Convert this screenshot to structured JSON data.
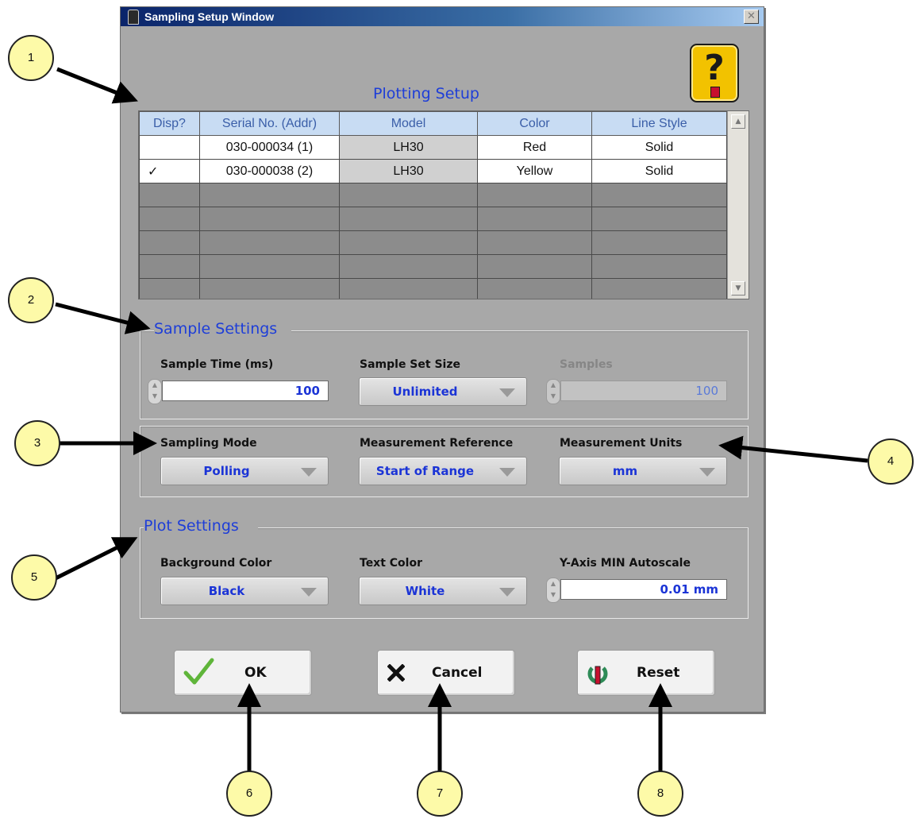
{
  "window": {
    "title": "Sampling Setup Window",
    "close_glyph": "✕",
    "help_glyph": "?"
  },
  "plotting": {
    "title": "Plotting Setup",
    "columns": [
      "Disp?",
      "Serial No. (Addr)",
      "Model",
      "Color",
      "Line Style"
    ],
    "rows": [
      [
        "",
        "030-000034 (1)",
        "LH30",
        "Red",
        "Solid"
      ],
      [
        "✓",
        "030-000038 (2)",
        "LH30",
        "Yellow",
        "Solid"
      ]
    ],
    "empty_rows": 5
  },
  "sample_settings": {
    "title": "Sample Settings",
    "sample_time_label": "Sample Time (ms)",
    "sample_time_value": "100",
    "set_size_label": "Sample Set Size",
    "set_size_value": "Unlimited",
    "samples_label": "Samples",
    "samples_value": "100"
  },
  "mode_settings": {
    "sampling_mode_label": "Sampling Mode",
    "sampling_mode_value": "Polling",
    "measurement_ref_label": "Measurement Reference",
    "measurement_ref_value": "Start of Range",
    "units_label": "Measurement Units",
    "units_value": "mm"
  },
  "plot_settings": {
    "title": "Plot Settings",
    "bg_label": "Background Color",
    "bg_value": "Black",
    "text_color_label": "Text Color",
    "text_color_value": "White",
    "yaxis_label": "Y-Axis MIN Autoscale",
    "yaxis_value": "0.01 mm"
  },
  "buttons": {
    "ok": "OK",
    "cancel": "Cancel",
    "reset": "Reset"
  },
  "callouts": [
    "1",
    "2",
    "3",
    "4",
    "5",
    "6",
    "7",
    "8"
  ],
  "colors": {
    "accent": "#1e3ed8",
    "window_bg": "#a8a8a8",
    "callout_fill": "#fdfaa8",
    "help_yellow": "#f2c200"
  }
}
